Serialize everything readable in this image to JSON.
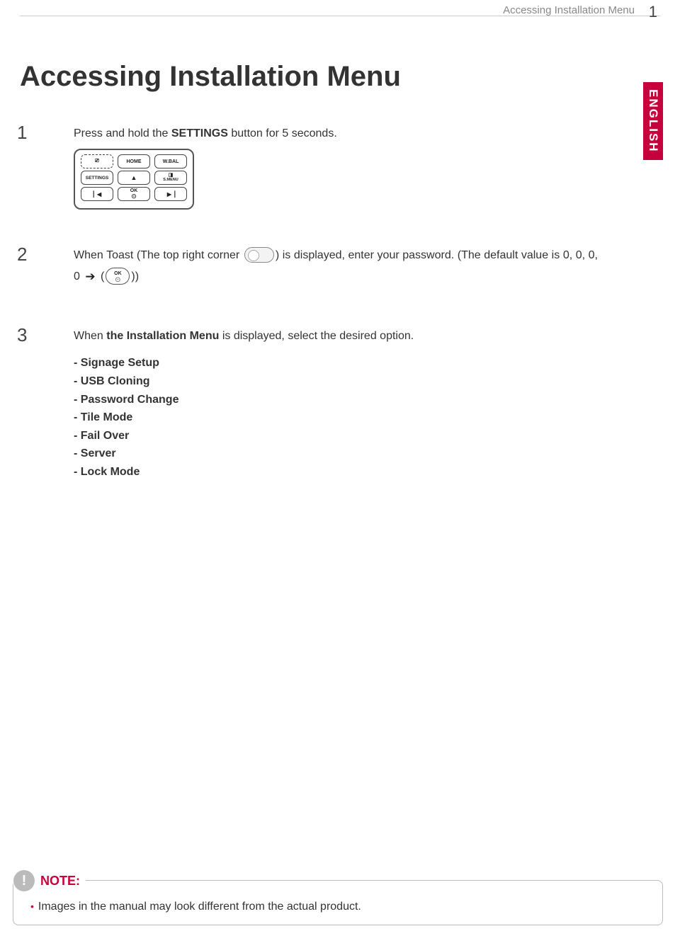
{
  "header": {
    "breadcrumb": "Accessing Installation Menu",
    "page_number": "1"
  },
  "side_tab": "ENGLISH",
  "heading": "Accessing Installation Menu",
  "steps": {
    "s1": {
      "num": "1",
      "text_a": "Press and hold the ",
      "bold_a": "SETTINGS",
      "text_b": " button for 5 seconds."
    },
    "s2": {
      "num": "2",
      "text_a": "When Toast (The top right corner ",
      "text_b": ") is displayed, enter your password. (The default value is 0, 0, 0, 0 ",
      "text_c": ")"
    },
    "s3": {
      "num": "3",
      "text_a": "When ",
      "bold_a": "the Installation Menu",
      "text_b": " is displayed, select the desired option.",
      "menu": {
        "m1": "- Signage Setup",
        "m2": "- USB Cloning",
        "m3": "- Password Change",
        "m4": "- Tile Mode",
        "m5": "- Fail Over",
        "m6": "- Server",
        "m7": "- Lock Mode"
      }
    }
  },
  "remote": {
    "r1a": "⎚",
    "r1b": "HOME",
    "r1c": "W.BAL",
    "r2a": "SETTINGS",
    "r2c_label": "S.MENU",
    "r3b_ok": "OK"
  },
  "ok_button": {
    "label": "OK"
  },
  "note": {
    "label": "NOTE:",
    "body": "Images in the manual may look different from the actual product."
  }
}
